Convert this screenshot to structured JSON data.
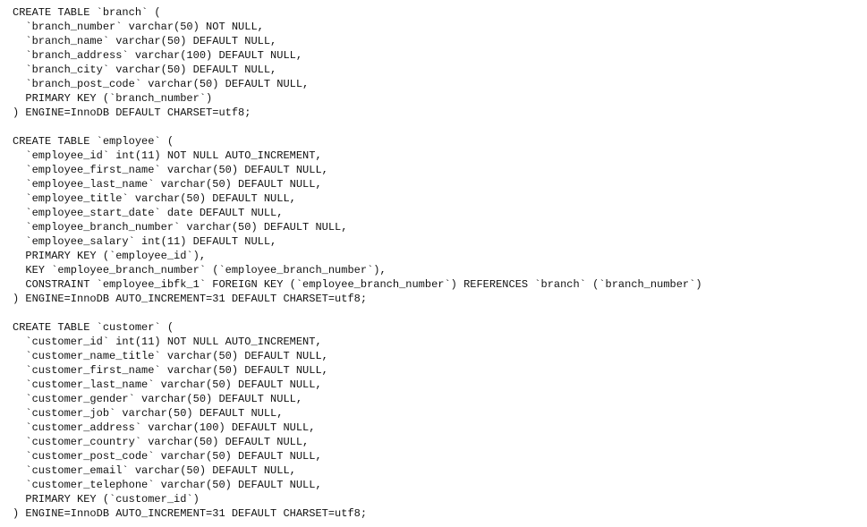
{
  "lines": [
    "CREATE TABLE `branch` (",
    "  `branch_number` varchar(50) NOT NULL,",
    "  `branch_name` varchar(50) DEFAULT NULL,",
    "  `branch_address` varchar(100) DEFAULT NULL,",
    "  `branch_city` varchar(50) DEFAULT NULL,",
    "  `branch_post_code` varchar(50) DEFAULT NULL,",
    "  PRIMARY KEY (`branch_number`)",
    ") ENGINE=InnoDB DEFAULT CHARSET=utf8;",
    "",
    "CREATE TABLE `employee` (",
    "  `employee_id` int(11) NOT NULL AUTO_INCREMENT,",
    "  `employee_first_name` varchar(50) DEFAULT NULL,",
    "  `employee_last_name` varchar(50) DEFAULT NULL,",
    "  `employee_title` varchar(50) DEFAULT NULL,",
    "  `employee_start_date` date DEFAULT NULL,",
    "  `employee_branch_number` varchar(50) DEFAULT NULL,",
    "  `employee_salary` int(11) DEFAULT NULL,",
    "  PRIMARY KEY (`employee_id`),",
    "  KEY `employee_branch_number` (`employee_branch_number`),",
    "  CONSTRAINT `employee_ibfk_1` FOREIGN KEY (`employee_branch_number`) REFERENCES `branch` (`branch_number`)",
    ") ENGINE=InnoDB AUTO_INCREMENT=31 DEFAULT CHARSET=utf8;",
    "",
    "CREATE TABLE `customer` (",
    "  `customer_id` int(11) NOT NULL AUTO_INCREMENT,",
    "  `customer_name_title` varchar(50) DEFAULT NULL,",
    "  `customer_first_name` varchar(50) DEFAULT NULL,",
    "  `customer_last_name` varchar(50) DEFAULT NULL,",
    "  `customer_gender` varchar(50) DEFAULT NULL,",
    "  `customer_job` varchar(50) DEFAULT NULL,",
    "  `customer_address` varchar(100) DEFAULT NULL,",
    "  `customer_country` varchar(50) DEFAULT NULL,",
    "  `customer_post_code` varchar(50) DEFAULT NULL,",
    "  `customer_email` varchar(50) DEFAULT NULL,",
    "  `customer_telephone` varchar(50) DEFAULT NULL,",
    "  PRIMARY KEY (`customer_id`)",
    ") ENGINE=InnoDB AUTO_INCREMENT=31 DEFAULT CHARSET=utf8;"
  ]
}
